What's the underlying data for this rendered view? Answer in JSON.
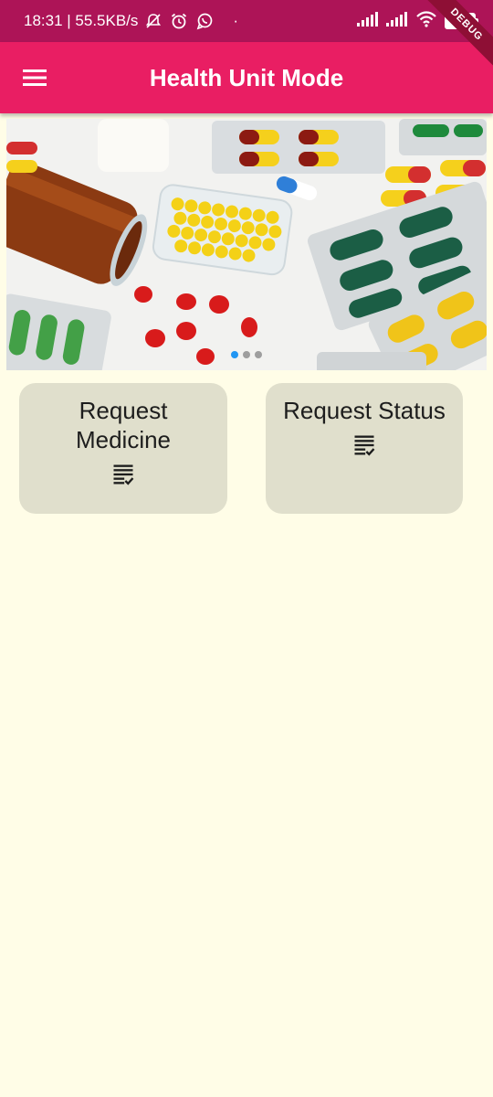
{
  "status_bar": {
    "time_speed": "18:31 | 55.5KB/s",
    "dot": "·",
    "battery_level": "100",
    "icons": [
      "muted-notifications-icon",
      "alarm-icon",
      "whatsapp-icon",
      "signal-icon",
      "signal-icon",
      "wifi-icon",
      "battery-icon"
    ]
  },
  "debug_banner": "DEBUG",
  "app_bar": {
    "title": "Health Unit Mode",
    "menu_icon": "hamburger-menu-icon",
    "color": "#e91e63"
  },
  "carousel": {
    "image_description_icon": "medicine-pills-photo",
    "page_count": 3,
    "active_index": 0,
    "active_color": "#2196f3"
  },
  "cards": [
    {
      "label": "Request Medicine",
      "icon": "checklist-icon"
    },
    {
      "label": "Request Status",
      "icon": "checklist-icon"
    }
  ],
  "colors": {
    "background": "#fffde7",
    "card": "#e0dfcc",
    "status_bar": "#ad1457"
  }
}
